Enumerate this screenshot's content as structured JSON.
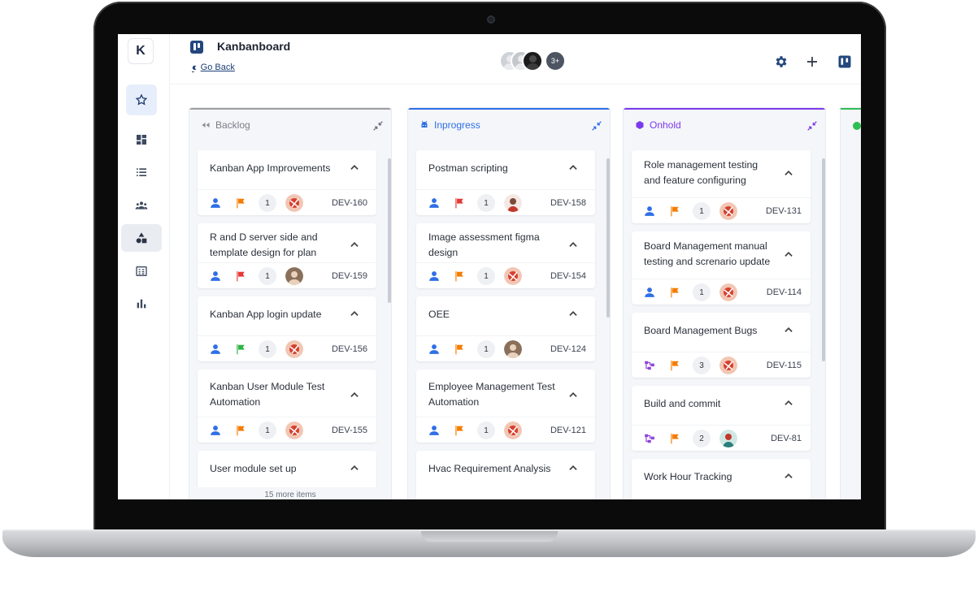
{
  "header": {
    "title": "Kanbanboard",
    "go_back": "Go Back",
    "avatar_more": "3+"
  },
  "sidebar": {
    "logo": "K",
    "items": [
      "star-icon",
      "dashboard-icon",
      "list-icon",
      "team-icon",
      "shapes-icon",
      "report-icon",
      "chart-icon"
    ]
  },
  "colors": {
    "backlog": "#9e9e9e",
    "inprogress": "#2f6fe6",
    "onhold": "#7c3aed",
    "done": "#2fbf55",
    "flag_orange": "#f57c00",
    "flag_red": "#e53935",
    "flag_green": "#2fb344",
    "user_blue": "#2f6fe6",
    "subtask_purple": "#8e44d8"
  },
  "columns": [
    {
      "name": "Backlog",
      "more_items": "15 more items",
      "cards": [
        {
          "title": "Kanban App Improvements",
          "count": "1",
          "id": "DEV-160",
          "flag": "orange",
          "icon": "user"
        },
        {
          "title": "R and D server side and template design for plan",
          "count": "1",
          "id": "DEV-159",
          "flag": "red",
          "icon": "user"
        },
        {
          "title": "Kanban App login update",
          "count": "1",
          "id": "DEV-156",
          "flag": "green",
          "icon": "user"
        },
        {
          "title": "Kanban User Module Test Automation",
          "count": "1",
          "id": "DEV-155",
          "flag": "orange",
          "icon": "user"
        },
        {
          "title": "User module set up",
          "count": "",
          "id": "",
          "flag": "",
          "icon": ""
        }
      ]
    },
    {
      "name": "Inprogress",
      "cards": [
        {
          "title": "Postman scripting",
          "count": "1",
          "id": "DEV-158",
          "flag": "red",
          "icon": "user"
        },
        {
          "title": "Image assessment figma design",
          "count": "1",
          "id": "DEV-154",
          "flag": "orange",
          "icon": "user"
        },
        {
          "title": "OEE",
          "count": "1",
          "id": "DEV-124",
          "flag": "orange",
          "icon": "user"
        },
        {
          "title": "Employee Management Test Automation",
          "count": "1",
          "id": "DEV-121",
          "flag": "orange",
          "icon": "user"
        },
        {
          "title": "Hvac Requirement Analysis",
          "count": "",
          "id": "",
          "flag": "",
          "icon": ""
        }
      ]
    },
    {
      "name": "Onhold",
      "cards": [
        {
          "title": "Role management testing and feature configuring",
          "count": "1",
          "id": "DEV-131",
          "flag": "orange",
          "icon": "user"
        },
        {
          "title": "Board Management manual testing and screnario update",
          "count": "1",
          "id": "DEV-114",
          "flag": "orange",
          "icon": "user"
        },
        {
          "title": "Board Management Bugs",
          "count": "3",
          "id": "DEV-115",
          "flag": "orange",
          "icon": "subtask"
        },
        {
          "title": "Build and commit",
          "count": "2",
          "id": "DEV-81",
          "flag": "orange",
          "icon": "subtask"
        },
        {
          "title": "Work Hour Tracking",
          "count": "",
          "id": "",
          "flag": "",
          "icon": ""
        }
      ]
    }
  ]
}
